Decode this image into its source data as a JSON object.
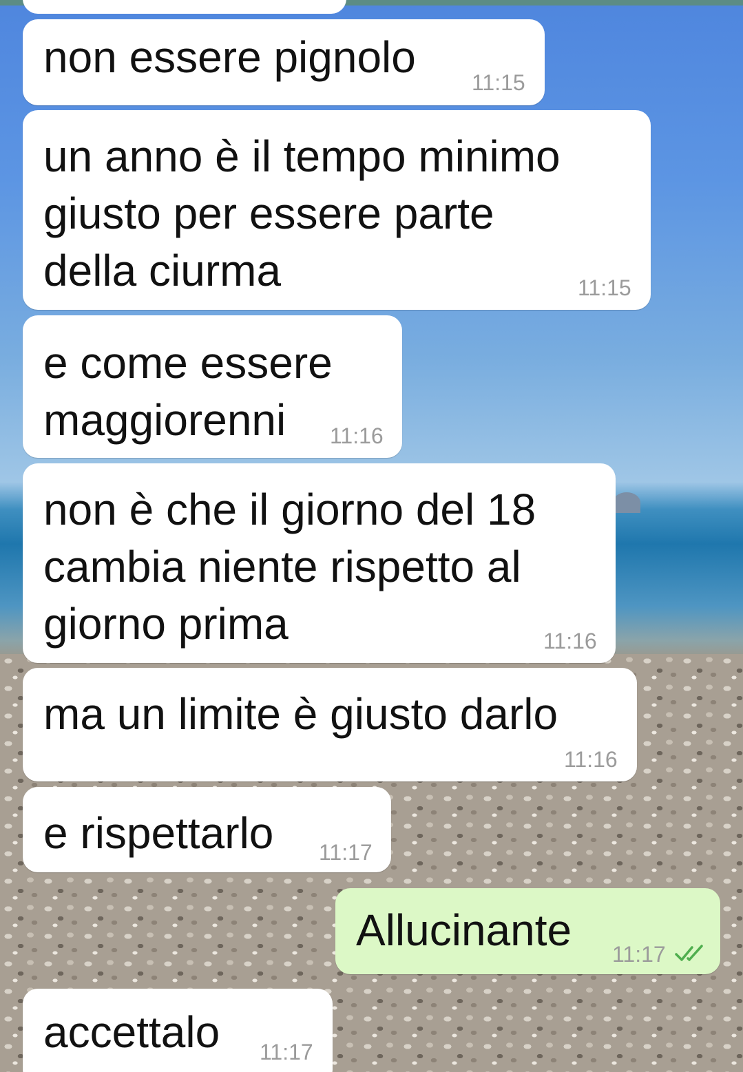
{
  "chat": {
    "messages": [
      {
        "text": "non essere pignolo",
        "time": "11:15",
        "direction": "incoming"
      },
      {
        "text": "un anno è il tempo minimo\ngiusto per essere parte\ndella ciurma",
        "time": "11:15",
        "direction": "incoming"
      },
      {
        "text": "e come essere\nmaggiorenni",
        "time": "11:16",
        "direction": "incoming"
      },
      {
        "text": "non è che il giorno del 18\ncambia niente rispetto al\ngiorno prima",
        "time": "11:16",
        "direction": "incoming"
      },
      {
        "text": "ma un limite è giusto darlo",
        "time": "11:16",
        "direction": "incoming"
      },
      {
        "text": "e rispettarlo",
        "time": "11:17",
        "direction": "incoming"
      },
      {
        "text": "Allucinante",
        "time": "11:17",
        "direction": "outgoing",
        "status_icon": "double-check-icon"
      },
      {
        "text": "accettalo",
        "time": "11:17",
        "direction": "incoming"
      }
    ]
  },
  "colors": {
    "incoming_bubble": "#ffffff",
    "outgoing_bubble": "#dcf8c6",
    "timestamp": "#9b9b9b",
    "read_ticks": "#4fae4e"
  }
}
